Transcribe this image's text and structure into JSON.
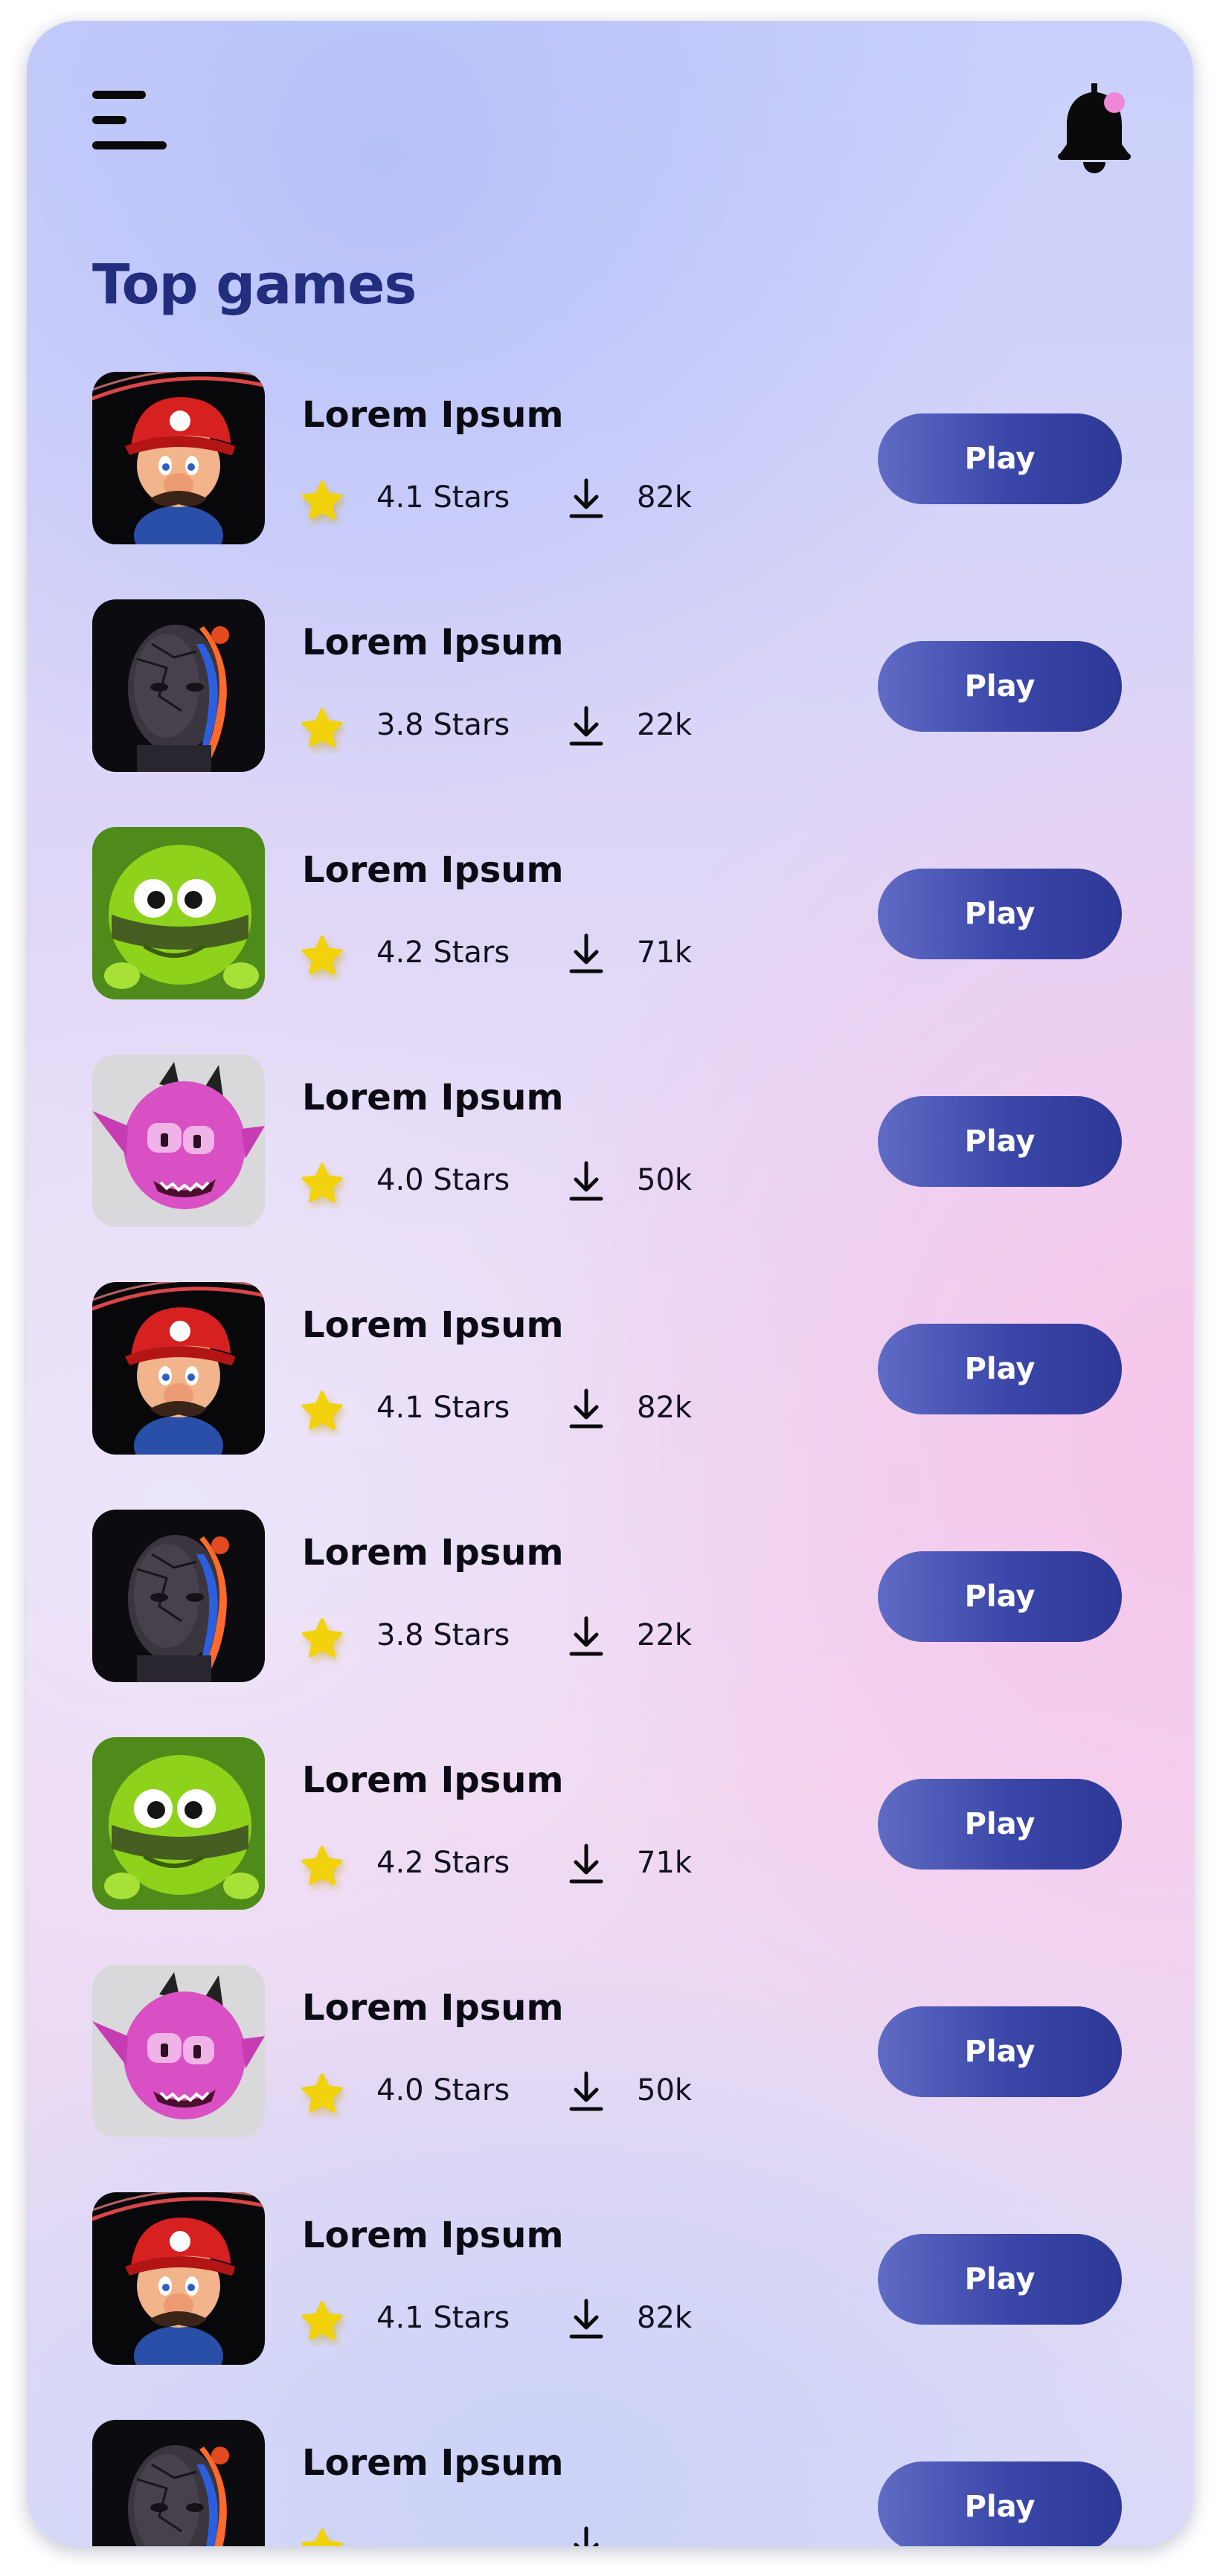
{
  "header": {
    "menu_icon": "hamburger-menu-icon",
    "notification_icon": "bell-icon",
    "notification_dot_color": "#ee88d6"
  },
  "page": {
    "title": "Top games"
  },
  "colors": {
    "title": "#222d7e",
    "button_start": "#5f6bc4",
    "button_end": "#2d3896",
    "star": "#f1d20a"
  },
  "games": [
    {
      "title": "Lorem Ipsum",
      "rating": "4.1 Stars",
      "downloads": "82k",
      "button": "Play",
      "art": "plumber"
    },
    {
      "title": "Lorem Ipsum",
      "rating": "3.8 Stars",
      "downloads": "22k",
      "button": "Play",
      "art": "cyber-face"
    },
    {
      "title": "Lorem Ipsum",
      "rating": "4.2 Stars",
      "downloads": "71k",
      "button": "Play",
      "art": "green-alien"
    },
    {
      "title": "Lorem Ipsum",
      "rating": "4.0 Stars",
      "downloads": "50k",
      "button": "Play",
      "art": "pink-monster"
    },
    {
      "title": "Lorem Ipsum",
      "rating": "4.1 Stars",
      "downloads": "82k",
      "button": "Play",
      "art": "plumber"
    },
    {
      "title": "Lorem Ipsum",
      "rating": "3.8 Stars",
      "downloads": "22k",
      "button": "Play",
      "art": "cyber-face"
    },
    {
      "title": "Lorem Ipsum",
      "rating": "4.2 Stars",
      "downloads": "71k",
      "button": "Play",
      "art": "green-alien"
    },
    {
      "title": "Lorem Ipsum",
      "rating": "4.0 Stars",
      "downloads": "50k",
      "button": "Play",
      "art": "pink-monster"
    },
    {
      "title": "Lorem Ipsum",
      "rating": "4.1 Stars",
      "downloads": "82k",
      "button": "Play",
      "art": "plumber"
    },
    {
      "title": "Lorem Ipsum",
      "rating": "",
      "downloads": "",
      "button": "Play",
      "art": "cyber-face"
    }
  ]
}
